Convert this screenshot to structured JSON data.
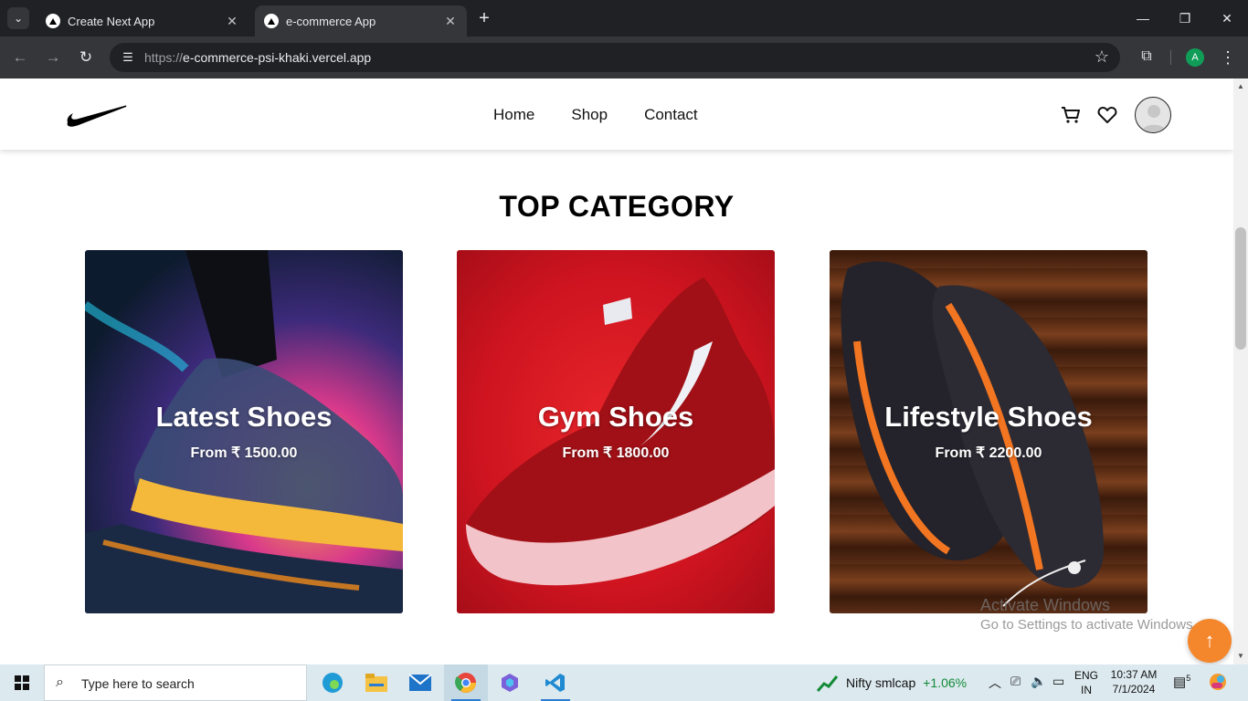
{
  "browser": {
    "tabs": [
      {
        "title": "Create Next App",
        "active": false
      },
      {
        "title": "e-commerce App",
        "active": true
      }
    ],
    "url": {
      "scheme": "https://",
      "host": "e-commerce-psi-khaki.vercel.app"
    },
    "profile_initial": "A"
  },
  "site": {
    "nav": {
      "home": "Home",
      "shop": "Shop",
      "contact": "Contact"
    },
    "section_title": "TOP CATEGORY",
    "categories": [
      {
        "title": "Latest Shoes",
        "price": "From ₹ 1500.00"
      },
      {
        "title": "Gym Shoes",
        "price": "From ₹ 1800.00"
      },
      {
        "title": "Lifestyle Shoes",
        "price": "From ₹ 2200.00"
      }
    ],
    "brand_color": "#f4862b"
  },
  "watermark": {
    "line1": "Activate Windows",
    "line2": "Go to Settings to activate Windows."
  },
  "taskbar": {
    "search_placeholder": "Type here to search",
    "widget": {
      "name": "Nifty smlcap",
      "change": "+1.06%"
    },
    "lang": {
      "line1": "ENG",
      "line2": "IN"
    },
    "time": "10:37 AM",
    "date": "7/1/2024",
    "notifications": "5"
  }
}
